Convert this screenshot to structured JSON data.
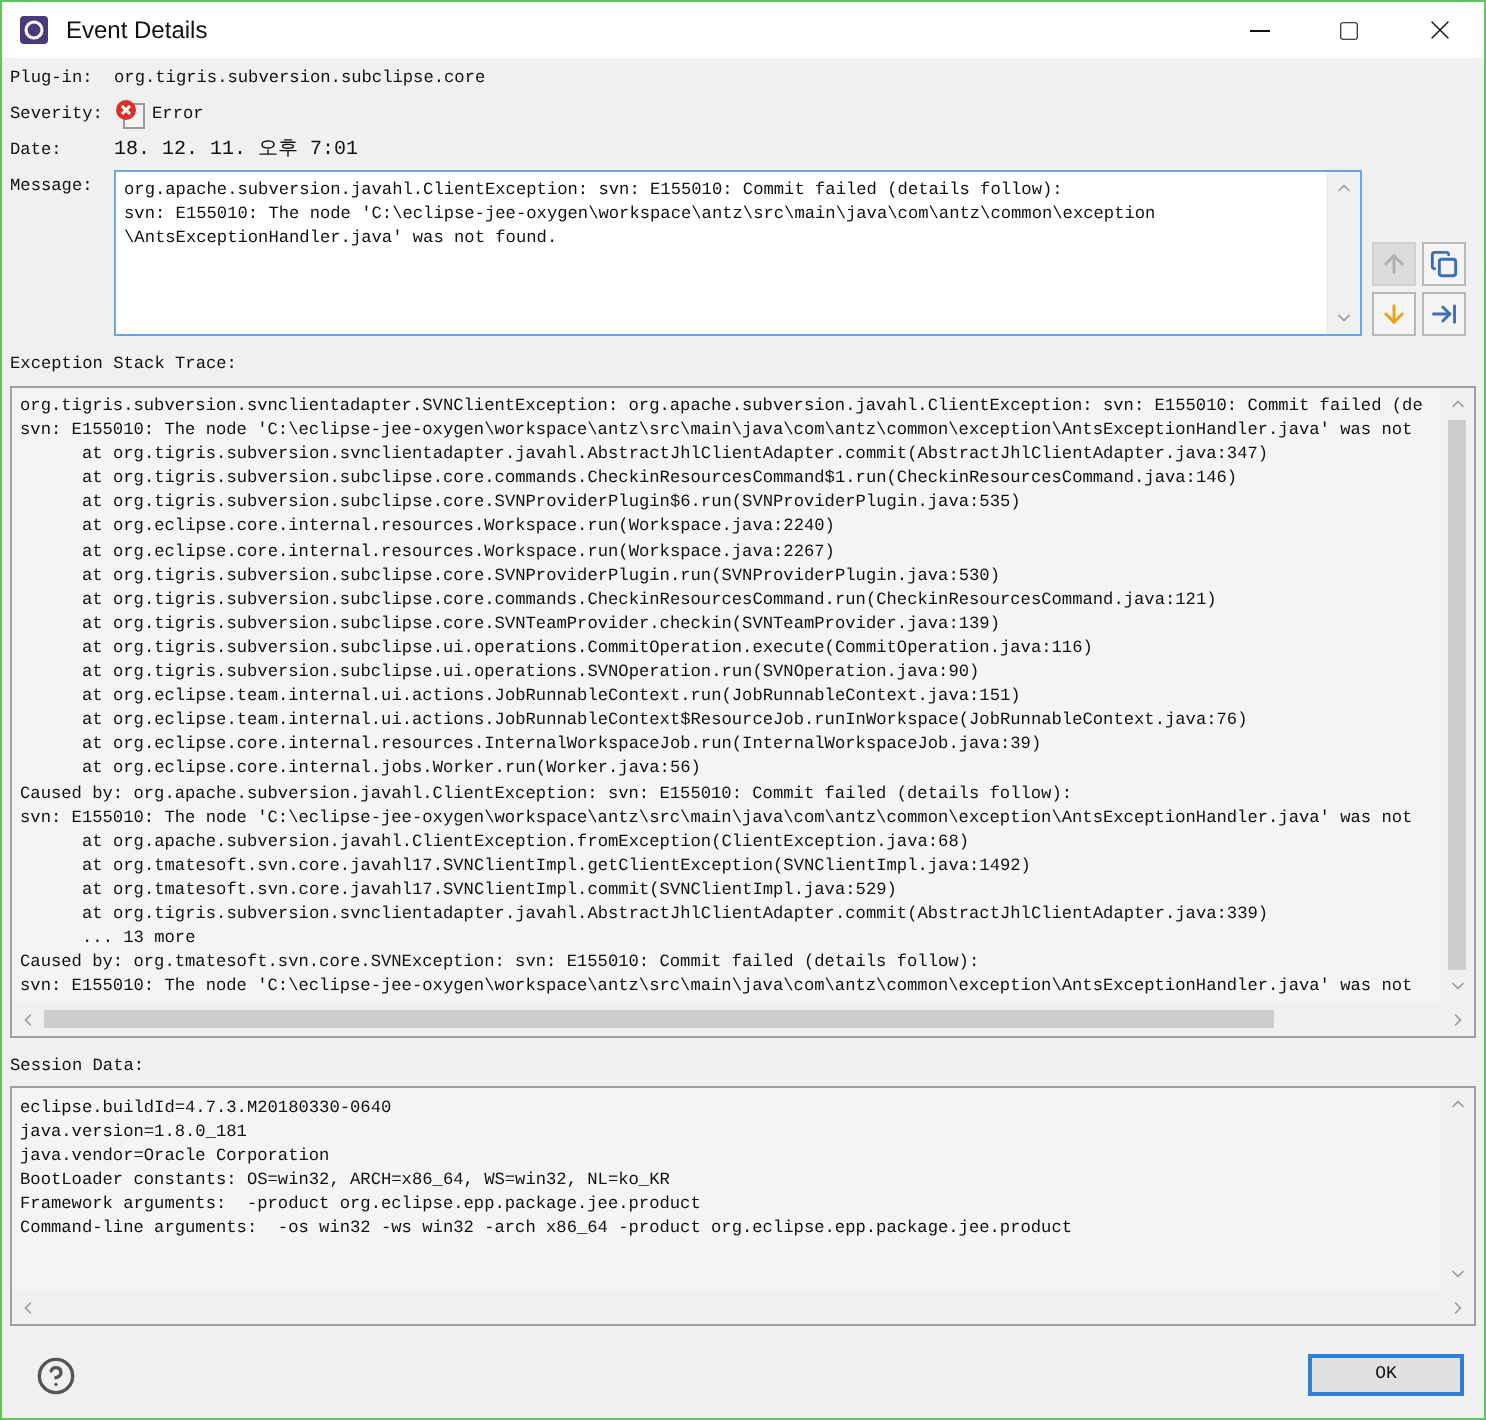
{
  "window": {
    "title": "Event Details"
  },
  "fields": [
    {
      "kind": "text",
      "label": "Plug-in:",
      "value": "org.tigris.subversion.subclipse.core"
    },
    {
      "kind": "severity",
      "label": "Severity:",
      "value": "Error"
    },
    {
      "kind": "date",
      "label": "Date:",
      "value": "18. 12. 11. 오후 7:01"
    }
  ],
  "message": {
    "label": "Message:",
    "lines": [
      "org.apache.subversion.javahl.ClientException: svn: E155010: Commit failed (details follow):",
      "svn: E155010: The node 'C:\\eclipse-jee-oxygen\\workspace\\antz\\src\\main\\java\\com\\antz\\common\\exception",
      "\\AntsExceptionHandler.java' was not found."
    ]
  },
  "toolbar": [
    {
      "kind": "previous",
      "disabled": true
    },
    {
      "kind": "copy",
      "disabled": false
    },
    {
      "kind": "next",
      "disabled": false
    },
    {
      "kind": "filter",
      "disabled": false
    }
  ],
  "stack_trace": {
    "label": "Exception Stack Trace:",
    "lines": [
      {
        "kind": "message",
        "text": "org.tigris.subversion.svnclientadapter.SVNClientException: org.apache.subversion.javahl.ClientException: svn: E155010: Commit failed (de"
      },
      {
        "kind": "message",
        "text": "svn: E155010: The node 'C:\\eclipse-jee-oxygen\\workspace\\antz\\src\\main\\java\\com\\antz\\common\\exception\\AntsExceptionHandler.java' was not"
      },
      {
        "kind": "frame",
        "text": "at org.tigris.subversion.svnclientadapter.javahl.AbstractJhlClientAdapter.commit(AbstractJhlClientAdapter.java:347)"
      },
      {
        "kind": "frame",
        "text": "at org.tigris.subversion.subclipse.core.commands.CheckinResourcesCommand$1.run(CheckinResourcesCommand.java:146)"
      },
      {
        "kind": "frame",
        "text": "at org.tigris.subversion.subclipse.core.SVNProviderPlugin$6.run(SVNProviderPlugin.java:535)"
      },
      {
        "kind": "frame",
        "text": "at org.eclipse.core.internal.resources.Workspace.run(Workspace.java:2240)"
      },
      {
        "kind": "frame",
        "text": "at org.eclipse.core.internal.resources.Workspace.run(Workspace.java:2267)"
      },
      {
        "kind": "frame",
        "text": "at org.tigris.subversion.subclipse.core.SVNProviderPlugin.run(SVNProviderPlugin.java:530)"
      },
      {
        "kind": "frame",
        "text": "at org.tigris.subversion.subclipse.core.commands.CheckinResourcesCommand.run(CheckinResourcesCommand.java:121)"
      },
      {
        "kind": "frame",
        "text": "at org.tigris.subversion.subclipse.core.SVNTeamProvider.checkin(SVNTeamProvider.java:139)"
      },
      {
        "kind": "frame",
        "text": "at org.tigris.subversion.subclipse.ui.operations.CommitOperation.execute(CommitOperation.java:116)"
      },
      {
        "kind": "frame",
        "text": "at org.tigris.subversion.subclipse.ui.operations.SVNOperation.run(SVNOperation.java:90)"
      },
      {
        "kind": "frame",
        "text": "at org.eclipse.team.internal.ui.actions.JobRunnableContext.run(JobRunnableContext.java:151)"
      },
      {
        "kind": "frame",
        "text": "at org.eclipse.team.internal.ui.actions.JobRunnableContext$ResourceJob.runInWorkspace(JobRunnableContext.java:76)"
      },
      {
        "kind": "frame",
        "text": "at org.eclipse.core.internal.resources.InternalWorkspaceJob.run(InternalWorkspaceJob.java:39)"
      },
      {
        "kind": "frame",
        "text": "at org.eclipse.core.internal.jobs.Worker.run(Worker.java:56)"
      },
      {
        "kind": "message",
        "text": "Caused by: org.apache.subversion.javahl.ClientException: svn: E155010: Commit failed (details follow):"
      },
      {
        "kind": "message",
        "text": "svn: E155010: The node 'C:\\eclipse-jee-oxygen\\workspace\\antz\\src\\main\\java\\com\\antz\\common\\exception\\AntsExceptionHandler.java' was not"
      },
      {
        "kind": "frame",
        "text": "at org.apache.subversion.javahl.ClientException.fromException(ClientException.java:68)"
      },
      {
        "kind": "frame",
        "text": "at org.tmatesoft.svn.core.javahl17.SVNClientImpl.getClientException(SVNClientImpl.java:1492)"
      },
      {
        "kind": "frame",
        "text": "at org.tmatesoft.svn.core.javahl17.SVNClientImpl.commit(SVNClientImpl.java:529)"
      },
      {
        "kind": "frame",
        "text": "at org.tigris.subversion.svnclientadapter.javahl.AbstractJhlClientAdapter.commit(AbstractJhlClientAdapter.java:339)"
      },
      {
        "kind": "frame",
        "text": "... 13 more"
      },
      {
        "kind": "message",
        "text": "Caused by: org.tmatesoft.svn.core.SVNException: svn: E155010: Commit failed (details follow):"
      },
      {
        "kind": "message",
        "text": "svn: E155010: The node 'C:\\eclipse-jee-oxygen\\workspace\\antz\\src\\main\\java\\com\\antz\\common\\exception\\AntsExceptionHandler.java' was not"
      }
    ]
  },
  "session_data": {
    "label": "Session Data:",
    "lines": [
      "eclipse.buildId=4.7.3.M20180330-0640",
      "java.version=1.8.0_181",
      "java.vendor=Oracle Corporation",
      "BootLoader constants: OS=win32, ARCH=x86_64, WS=win32, NL=ko_KR",
      "Framework arguments:  -product org.eclipse.epp.package.jee.product",
      "Command-line arguments:  -os win32 -ws win32 -arch x86_64 -product org.eclipse.epp.package.jee.product"
    ]
  },
  "buttons": [
    "OK"
  ]
}
